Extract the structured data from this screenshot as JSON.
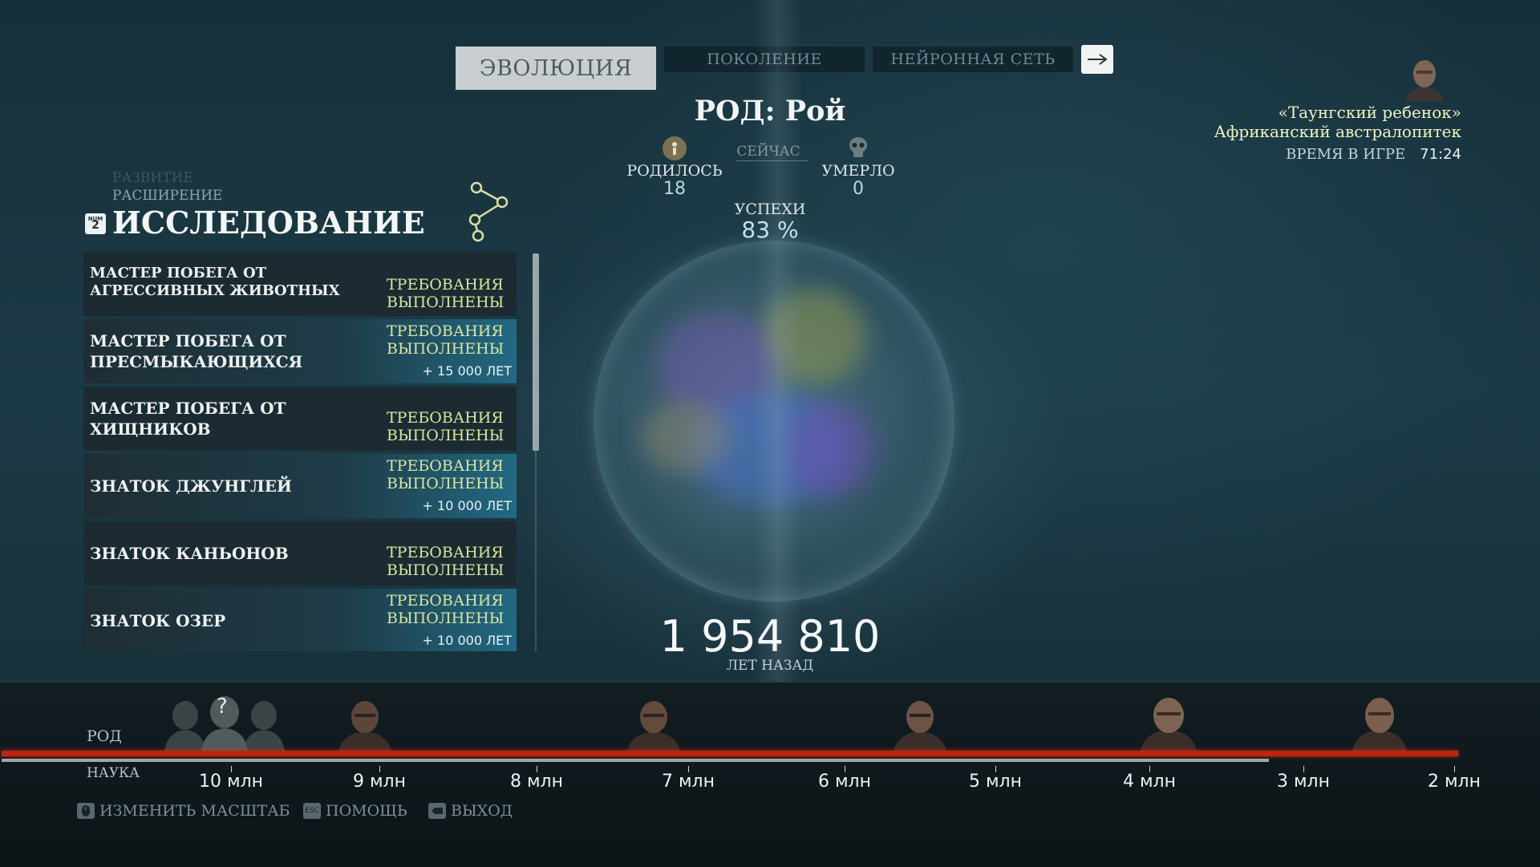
{
  "tabs": {
    "evolution": "ЭВОЛЮЦИЯ",
    "generation": "ПОКОЛЕНИЕ",
    "neural_network": "НЕЙРОННАЯ СЕТЬ"
  },
  "genus_title": "РОД: Рой",
  "stats": {
    "born_label": "РОДИЛОСЬ",
    "born_value": "18",
    "now_label": "СЕЙЧАС",
    "died_label": "УМЕРЛО",
    "died_value": "0",
    "success_label": "УСПЕХИ",
    "success_value": "83 %"
  },
  "panel": {
    "sub1": "РАЗВИТИЕ",
    "sub2": "РАСШИРЕНИЕ",
    "title": "ИССЛЕДОВАНИЕ",
    "num_key_small": "NUM",
    "num_key": "2",
    "items": [
      {
        "name": "МАСТЕР ПОБЕГА ОТ АГРЕССИВНЫХ ЖИВОТНЫХ",
        "req": "ТРЕБОВАНИЯ ВЫПОЛНЕНЫ",
        "years": ""
      },
      {
        "name": "МАСТЕР ПОБЕГА ОТ ПРЕСМЫКАЮЩИХСЯ",
        "req": "ТРЕБОВАНИЯ ВЫПОЛНЕНЫ",
        "years": "+ 15 000 ЛЕТ"
      },
      {
        "name": "МАСТЕР ПОБЕГА ОТ ХИЩНИКОВ",
        "req": "ТРЕБОВАНИЯ ВЫПОЛНЕНЫ",
        "years": ""
      },
      {
        "name": "ЗНАТОК ДЖУНГЛЕЙ",
        "req": "ТРЕБОВАНИЯ ВЫПОЛНЕНЫ",
        "years": "+ 10 000 ЛЕТ"
      },
      {
        "name": "ЗНАТОК КАНЬОНОВ",
        "req": "ТРЕБОВАНИЯ ВЫПОЛНЕНЫ",
        "years": ""
      },
      {
        "name": "ЗНАТОК ОЗЕР",
        "req": "ТРЕБОВАНИЯ ВЫПОЛНЕНЫ",
        "years": "+ 10 000 ЛЕТ"
      }
    ]
  },
  "years_ago": {
    "value": "1 954 810",
    "label": "ЛЕТ НАЗАД"
  },
  "character": {
    "name": "«Таунгский ребенок»",
    "species": "Африканский австралопитек",
    "ingame_label": "ВРЕМЯ В ИГРЕ",
    "ingame_value": "71:24"
  },
  "timeline": {
    "genus_label": "РОД",
    "science_label": "НАУКА",
    "unknown_mark": "?",
    "markers": [
      "10 млн",
      "9 млн",
      "8 млн",
      "7 млн",
      "6 млн",
      "5 млн",
      "4 млн",
      "3 млн",
      "2 млн"
    ]
  },
  "hints": {
    "zoom": "ИЗМЕНИТЬ МАСШТАБ",
    "help_key": "ESC",
    "help": "ПОМОЩЬ",
    "exit": "ВЫХОД"
  },
  "colors": {
    "accent_red": "#c0230f",
    "requirement_text": "#d8e5a0",
    "highlight_blue": "#226c86"
  }
}
